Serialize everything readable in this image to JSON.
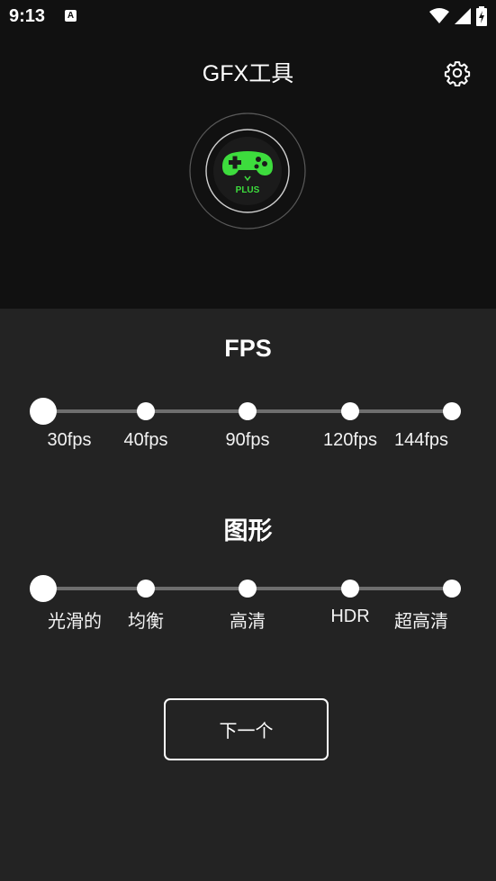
{
  "status_bar": {
    "time": "9:13",
    "notification_icon": "A",
    "icons": [
      "wifi-icon",
      "signal-icon",
      "battery-charging-icon"
    ]
  },
  "header": {
    "title": "GFX工具",
    "settings_icon": "gear-icon"
  },
  "logo": {
    "icon": "gamepad-icon",
    "text": "PLUS",
    "accent_color": "#3ddc3d"
  },
  "fps": {
    "title": "FPS",
    "options": [
      "30fps",
      "40fps",
      "90fps",
      "120fps",
      "144fps"
    ],
    "selected_index": 0
  },
  "graphics": {
    "title": "图形",
    "options": [
      "光滑的",
      "均衡",
      "高清",
      "HDR",
      "超高清"
    ],
    "selected_index": 0
  },
  "next_button": {
    "label": "下一个"
  },
  "colors": {
    "background": "#111111",
    "card": "#232323",
    "track": "#6e6e6e",
    "accent": "#3ddc3d"
  }
}
